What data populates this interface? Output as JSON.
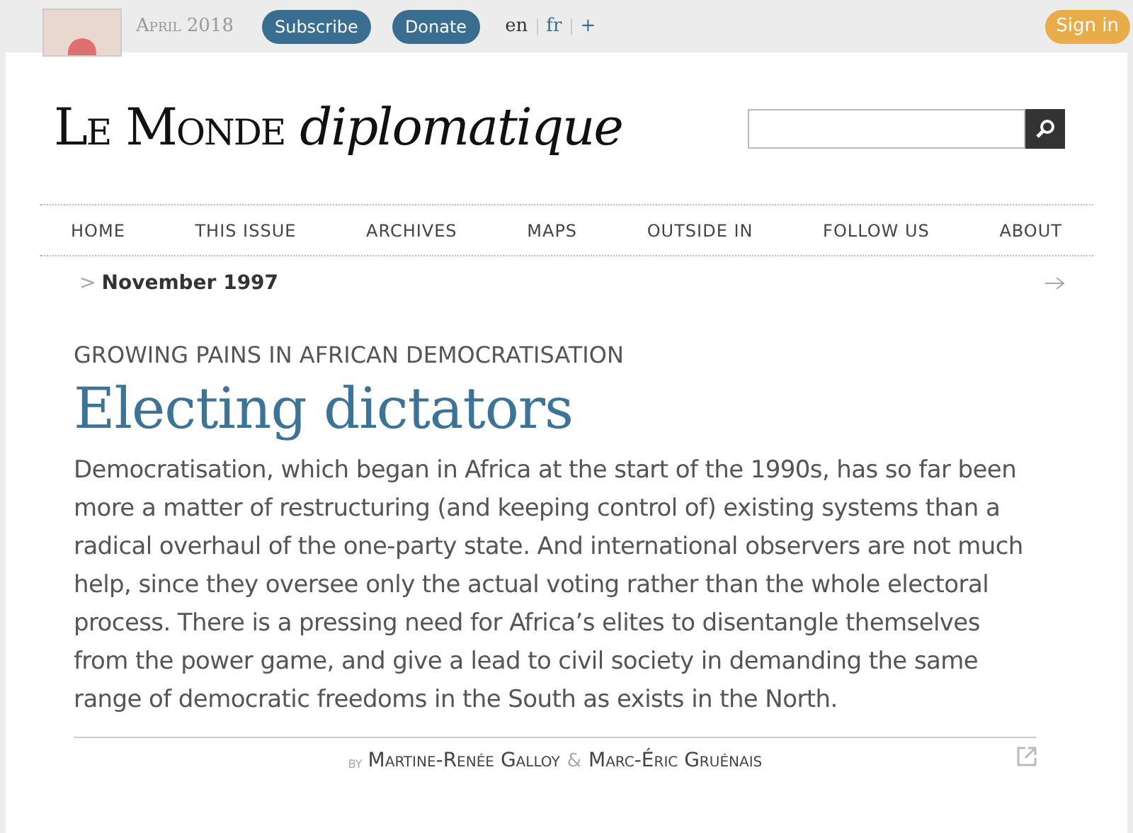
{
  "top_bar": {
    "issue": "April 2018",
    "buttons": [
      "Subscribe",
      "Donate"
    ],
    "languages": [
      {
        "label": "en",
        "selected": true
      },
      {
        "label": "fr",
        "selected": false
      },
      {
        "label": "+",
        "selected": false
      }
    ],
    "sign_in": "Sign in"
  },
  "masthead": {
    "title_main": "Le Monde",
    "title_italic": "diplomatique"
  },
  "nav": [
    "HOME",
    "THIS ISSUE",
    "ARCHIVES",
    "MAPS",
    "OUTSIDE IN",
    "FOLLOW US",
    "ABOUT"
  ],
  "breadcrumb": {
    "separator": ">",
    "label": "November 1997"
  },
  "article": {
    "kicker": "GROWING PAINS IN AFRICAN DEMOCRATISATION",
    "title": "Electing dictators",
    "lead": "Democratisation, which began in Africa at the start of the 1990s, has so far been more a matter of restructuring (and keeping control of) existing systems than a radical overhaul of the one-party state. And international observers are not much help, since they oversee only the actual voting rather than the whole electoral process. There is a pressing need for Africa’s elites to disentangle themselves from the power game, and give a lead to civil society in demanding the same range of democratic freedoms in the South as exists in the North.",
    "byline": {
      "prefix": "by",
      "authors": [
        "Martine-Renée Galloy",
        "Marc-Éric Gruénais"
      ],
      "joiner": "&"
    }
  }
}
